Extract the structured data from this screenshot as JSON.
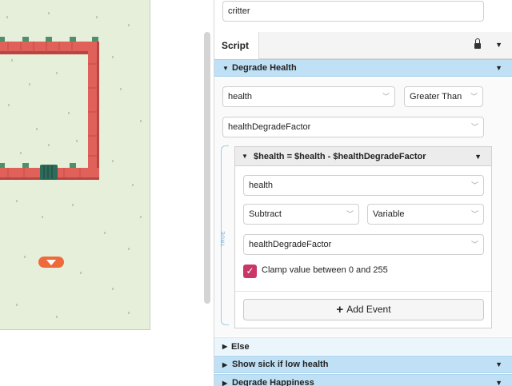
{
  "inspector": {
    "name_value": "critter",
    "tab_label": "Script",
    "tab_lock_icon": "lock-icon",
    "tab_menu_icon": "caret-down-icon"
  },
  "event_degrade_health": {
    "title": "Degrade Health",
    "condition_variable": "health",
    "condition_operator": "Greater Than",
    "condition_value": "healthDegradeFactor",
    "true_label": "TRUE",
    "inner_event": {
      "title": "$health = $health - $healthDegradeFactor",
      "variable": "health",
      "operation": "Subtract",
      "value_type": "Variable",
      "value": "healthDegradeFactor",
      "clamp_label": "Clamp value between 0 and 255",
      "clamp_checked": true
    },
    "add_event_label": "Add Event",
    "else_label": "Else"
  },
  "event_show_sick": {
    "title": "Show sick if low health"
  },
  "event_degrade_happiness": {
    "title": "Degrade Happiness"
  },
  "colors": {
    "event_header": "#bfe0f5",
    "checkbox": "#c9366a",
    "wall": "#e0605a",
    "grass": "#e6efd9",
    "trigger_marker": "#ef6a3b"
  }
}
